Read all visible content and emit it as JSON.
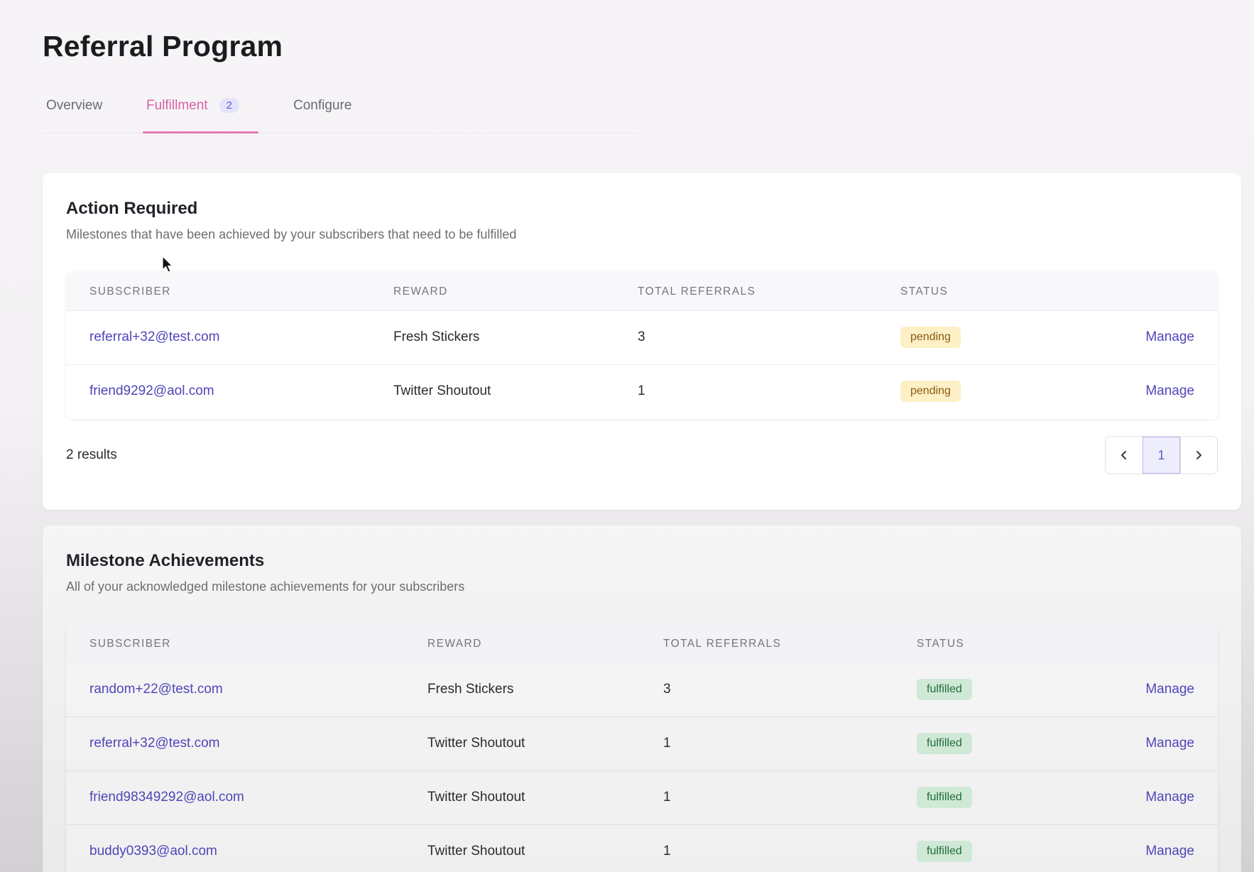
{
  "page": {
    "title": "Referral Program"
  },
  "tabs": [
    {
      "label": "Overview"
    },
    {
      "label": "Fulfillment",
      "badge": "2",
      "active": true
    },
    {
      "label": "Configure"
    }
  ],
  "columns": {
    "subscriber": "SUBSCRIBER",
    "reward": "REWARD",
    "total_referrals": "TOTAL REFERRALS",
    "status": "STATUS"
  },
  "action_required": {
    "title": "Action Required",
    "subtitle": "Milestones that have been achieved by your subscribers that need to be fulfilled",
    "rows": [
      {
        "email": "referral+32@test.com",
        "reward": "Fresh Stickers",
        "referrals": "3",
        "status": "pending",
        "action": "Manage"
      },
      {
        "email": "friend9292@aol.com",
        "reward": "Twitter Shoutout",
        "referrals": "1",
        "status": "pending",
        "action": "Manage"
      }
    ],
    "results": "2 results",
    "pagination": {
      "current": "1"
    }
  },
  "milestones": {
    "title": "Milestone Achievements",
    "subtitle": "All of your acknowledged milestone achievements for your subscribers",
    "rows": [
      {
        "email": "random+22@test.com",
        "reward": "Fresh Stickers",
        "referrals": "3",
        "status": "fulfilled",
        "action": "Manage"
      },
      {
        "email": "referral+32@test.com",
        "reward": "Twitter Shoutout",
        "referrals": "1",
        "status": "fulfilled",
        "action": "Manage"
      },
      {
        "email": "friend98349292@aol.com",
        "reward": "Twitter Shoutout",
        "referrals": "1",
        "status": "fulfilled",
        "action": "Manage"
      },
      {
        "email": "buddy0393@aol.com",
        "reward": "Twitter Shoutout",
        "referrals": "1",
        "status": "fulfilled",
        "action": "Manage"
      }
    ]
  },
  "colors": {
    "accent": "#d463a8",
    "link": "#4f46b8",
    "pending_bg": "#fdf0c6",
    "fulfilled_bg": "#cfe9d6"
  },
  "icons": {
    "prev": "chevron-left-icon",
    "next": "chevron-right-icon",
    "cursor": "mouse-pointer-icon"
  }
}
